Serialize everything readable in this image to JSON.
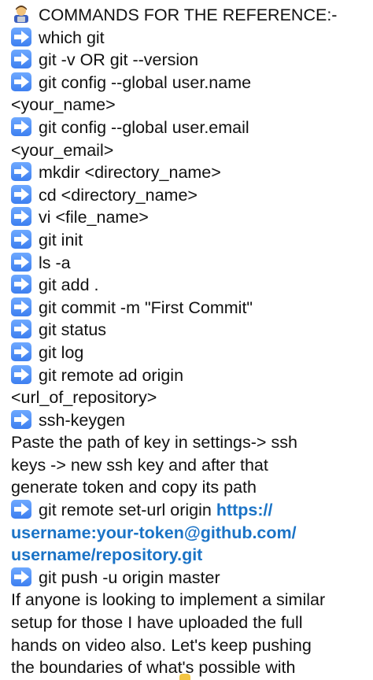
{
  "header": {
    "title": "COMMANDS FOR THE REFERENCE:-"
  },
  "commands": [
    "which git",
    "git -v OR git --version",
    "git config --global user.name",
    "<your_name>",
    "git config --global user.email",
    "<your_email>",
    "mkdir <directory_name>",
    "cd <directory_name>",
    "vi <file_name>",
    "git init",
    "ls -a",
    "git add .",
    "git commit -m \"First Commit\"",
    "git status",
    "git log",
    "git remote ad origin",
    "<url_of_repository>",
    "ssh-keygen"
  ],
  "note": {
    "line1": "Paste the path of key in settings-> ssh",
    "line2": "keys -> new ssh key and after that",
    "line3": "generate token and copy its path"
  },
  "set_url": {
    "prefix": "git remote set-url origin ",
    "link_part1": "https://",
    "link_part2": "username:your-token@github.com/",
    "link_part3": "username/repository.git"
  },
  "push": "git push -u origin master",
  "outro": {
    "line1": "If anyone is looking to implement a similar",
    "line2": "setup for those I have uploaded the full",
    "line3": "hands on video also. Let's keep pushing",
    "line4": "the boundaries of what's possible with"
  },
  "icons": {
    "header": "technologist-emoji-icon",
    "bullet": "right-arrow-emoji-icon"
  },
  "colors": {
    "text": "#111111",
    "link": "#1a73c6",
    "arrow": "#4a8df5"
  }
}
